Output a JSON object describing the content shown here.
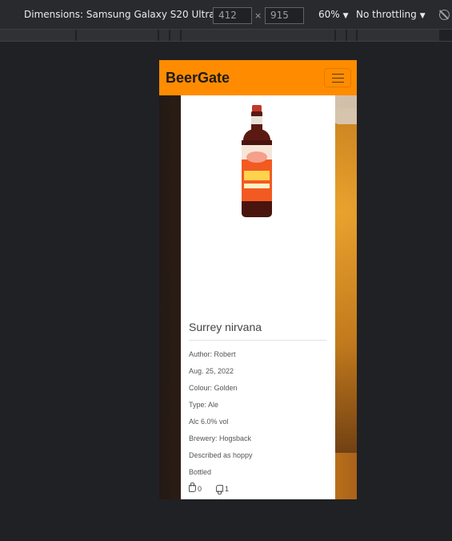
{
  "devtools": {
    "device_label": "Dimensions: Samsung Galaxy S20 Ultra",
    "width": "412",
    "height": "915",
    "times": "×",
    "zoom": "60%",
    "throttling": "No throttling",
    "caret": "▼"
  },
  "site": {
    "brand": "BeerGate",
    "colors": {
      "navbar": "#ff8c00",
      "card": "#ffffff"
    }
  },
  "beer": {
    "title": "Surrey nirvana",
    "author": "Author: Robert",
    "date": "Aug. 25, 2022",
    "colour": "Colour: Golden",
    "type": "Type: Ale",
    "alc": "Alc 6.0% vol",
    "brewery": "Brewery: Hogsback",
    "description": "Described as hoppy",
    "packaging": "Bottled",
    "likes": "0",
    "dislikes": "1"
  }
}
